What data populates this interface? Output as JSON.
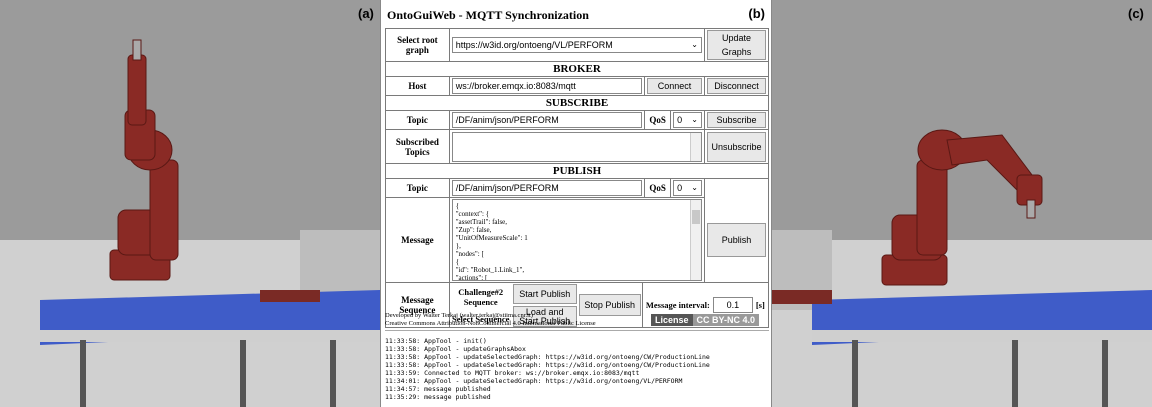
{
  "panels": {
    "left_tag": "(a)",
    "middle_tag": "(b)",
    "right_tag": "(c)"
  },
  "gui": {
    "title": "OntoGuiWeb - MQTT Synchronization",
    "root_graph": {
      "label": "Select root graph",
      "value": "https://w3id.org/ontoeng/VL/PERFORM",
      "button": "Update Graphs"
    },
    "broker": {
      "section": "BROKER",
      "host_label": "Host",
      "host_value": "ws://broker.emqx.io:8083/mqtt",
      "connect": "Connect",
      "disconnect": "Disconnect"
    },
    "subscribe": {
      "section": "SUBSCRIBE",
      "topic_label": "Topic",
      "topic_value": "/DF/anim/json/PERFORM",
      "qos_label": "QoS",
      "qos_value": "0",
      "subscribe_button": "Subscribe",
      "subscribed_label": "Subscribed Topics",
      "unsubscribe_button": "Unsubscribe"
    },
    "publish": {
      "section": "PUBLISH",
      "topic_label": "Topic",
      "topic_value": "/DF/anim/json/PERFORM",
      "qos_label": "QoS",
      "qos_value": "0",
      "message_label": "Message",
      "message_lines": [
        "{",
        "\"context\": {",
        "\"assetTrail\": false,",
        "\"Zup\": false,",
        "\"UnitOfMeasureScale\": 1",
        "},",
        "\"nodes\": [",
        "{",
        "\"id\": \"Robot_1.Link_1\",",
        "\"actions\": [",
        "{"
      ],
      "publish_button": "Publish"
    },
    "sequence": {
      "label": "Message Sequence",
      "challenge": "Challenge#2 Sequence",
      "select": "Select Sequence",
      "start_publish": "Start Publish",
      "load_start": "Load and Start Publish",
      "stop_publish": "Stop Publish",
      "interval_label": "Message interval:",
      "interval_value": "0.1",
      "interval_unit": "[s]"
    },
    "credit": [
      "Developed by Walter Terkaj (walter.terkaj@stiima.cnr.it)",
      "Creative Commons Attribution-NonCommercial 4.0 International Public License"
    ],
    "license": {
      "left": "License",
      "right": "CC BY-NC 4.0"
    },
    "log": [
      "11:33:58: AppTool - init()",
      "11:33:58: AppTool - updateGraphsAbox",
      "11:33:58: AppTool - updateSelectedGraph: https://w3id.org/ontoeng/CW/ProductionLine",
      "11:33:58: AppTool - updateSelectedGraph: https://w3id.org/ontoeng/CW/ProductionLine",
      "11:33:59: Connected to MQTT broker: ws://broker.emqx.io:8083/mqtt",
      "11:34:01: AppTool - updateSelectedGraph: https://w3id.org/ontoeng/VL/PERFORM",
      "11:34:57: message published",
      "11:35:29: message published"
    ]
  },
  "colors": {
    "robot": "#8a2a25",
    "conveyor": "#3f5cc8",
    "floor": "#d6d6d6"
  }
}
